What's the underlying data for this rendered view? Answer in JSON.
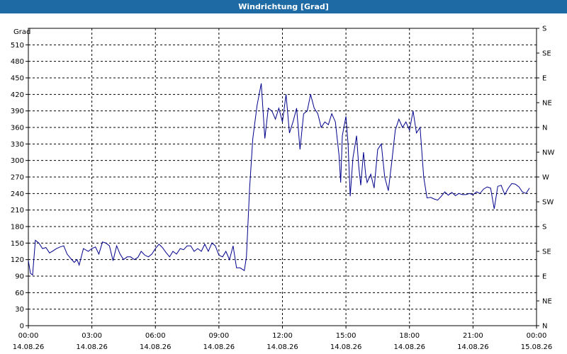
{
  "window": {
    "title": "Windrichtung [Grad]"
  },
  "chart_data": {
    "type": "line",
    "title": "Windrichtung [Grad]",
    "ylabel": "Grad",
    "ylim": [
      0,
      540
    ],
    "xlim": [
      0,
      24
    ],
    "grid": true,
    "line_color": "#00008b",
    "y_ticks": [
      0,
      30,
      60,
      90,
      120,
      150,
      180,
      210,
      240,
      270,
      300,
      330,
      360,
      390,
      420,
      450,
      480,
      510
    ],
    "y2_ticks": [
      {
        "value": 0,
        "label": "N"
      },
      {
        "value": 45,
        "label": "NE"
      },
      {
        "value": 90,
        "label": "E"
      },
      {
        "value": 135,
        "label": "SE"
      },
      {
        "value": 180,
        "label": "S"
      },
      {
        "value": 225,
        "label": "SW"
      },
      {
        "value": 270,
        "label": "W"
      },
      {
        "value": 315,
        "label": "NW"
      },
      {
        "value": 360,
        "label": "N"
      },
      {
        "value": 405,
        "label": "NE"
      },
      {
        "value": 450,
        "label": "E"
      },
      {
        "value": 495,
        "label": "SE"
      },
      {
        "value": 540,
        "label": "S"
      }
    ],
    "x_ticks": [
      {
        "hour": 0,
        "time": "00:00",
        "date": "14.08.26"
      },
      {
        "hour": 3,
        "time": "03:00",
        "date": "14.08.26"
      },
      {
        "hour": 6,
        "time": "06:00",
        "date": "14.08.26"
      },
      {
        "hour": 9,
        "time": "09:00",
        "date": "14.08.26"
      },
      {
        "hour": 12,
        "time": "12:00",
        "date": "14.08.26"
      },
      {
        "hour": 15,
        "time": "15:00",
        "date": "14.08.26"
      },
      {
        "hour": 18,
        "time": "18:00",
        "date": "14.08.26"
      },
      {
        "hour": 21,
        "time": "21:00",
        "date": "14.08.26"
      },
      {
        "hour": 24,
        "time": "00:00",
        "date": "15.08.26"
      }
    ],
    "series": [
      {
        "points": [
          [
            0.0,
            118
          ],
          [
            0.1,
            95
          ],
          [
            0.2,
            92
          ],
          [
            0.33,
            155
          ],
          [
            0.5,
            150
          ],
          [
            0.67,
            140
          ],
          [
            0.83,
            142
          ],
          [
            1.0,
            132
          ],
          [
            1.17,
            136
          ],
          [
            1.33,
            140
          ],
          [
            1.5,
            143
          ],
          [
            1.67,
            145
          ],
          [
            1.83,
            130
          ],
          [
            2.0,
            122
          ],
          [
            2.17,
            115
          ],
          [
            2.3,
            120
          ],
          [
            2.4,
            110
          ],
          [
            2.5,
            125
          ],
          [
            2.6,
            140
          ],
          [
            2.83,
            135
          ],
          [
            3.0,
            140
          ],
          [
            3.17,
            143
          ],
          [
            3.33,
            130
          ],
          [
            3.5,
            152
          ],
          [
            3.67,
            150
          ],
          [
            3.83,
            145
          ],
          [
            4.0,
            118
          ],
          [
            4.17,
            145
          ],
          [
            4.33,
            130
          ],
          [
            4.5,
            120
          ],
          [
            4.67,
            125
          ],
          [
            4.83,
            125
          ],
          [
            5.0,
            120
          ],
          [
            5.17,
            124
          ],
          [
            5.33,
            135
          ],
          [
            5.5,
            128
          ],
          [
            5.67,
            125
          ],
          [
            5.83,
            130
          ],
          [
            6.0,
            140
          ],
          [
            6.17,
            148
          ],
          [
            6.33,
            142
          ],
          [
            6.5,
            133
          ],
          [
            6.67,
            125
          ],
          [
            6.83,
            135
          ],
          [
            7.0,
            130
          ],
          [
            7.17,
            140
          ],
          [
            7.33,
            138
          ],
          [
            7.5,
            145
          ],
          [
            7.67,
            145
          ],
          [
            7.83,
            135
          ],
          [
            8.0,
            140
          ],
          [
            8.17,
            135
          ],
          [
            8.33,
            148
          ],
          [
            8.5,
            135
          ],
          [
            8.67,
            150
          ],
          [
            8.83,
            145
          ],
          [
            9.0,
            128
          ],
          [
            9.17,
            125
          ],
          [
            9.33,
            135
          ],
          [
            9.5,
            120
          ],
          [
            9.67,
            145
          ],
          [
            9.83,
            105
          ],
          [
            10.0,
            105
          ],
          [
            10.2,
            100
          ],
          [
            10.3,
            125
          ],
          [
            10.45,
            250
          ],
          [
            10.6,
            340
          ],
          [
            10.8,
            400
          ],
          [
            11.0,
            440
          ],
          [
            11.17,
            340
          ],
          [
            11.33,
            395
          ],
          [
            11.5,
            390
          ],
          [
            11.67,
            375
          ],
          [
            11.83,
            395
          ],
          [
            12.0,
            370
          ],
          [
            12.17,
            420
          ],
          [
            12.33,
            350
          ],
          [
            12.5,
            370
          ],
          [
            12.67,
            395
          ],
          [
            12.83,
            320
          ],
          [
            13.0,
            385
          ],
          [
            13.17,
            390
          ],
          [
            13.33,
            420
          ],
          [
            13.5,
            395
          ],
          [
            13.67,
            385
          ],
          [
            13.83,
            360
          ],
          [
            14.0,
            370
          ],
          [
            14.17,
            365
          ],
          [
            14.33,
            385
          ],
          [
            14.5,
            370
          ],
          [
            14.67,
            310
          ],
          [
            14.75,
            260
          ],
          [
            14.83,
            345
          ],
          [
            15.0,
            380
          ],
          [
            15.1,
            330
          ],
          [
            15.2,
            235
          ],
          [
            15.33,
            305
          ],
          [
            15.5,
            345
          ],
          [
            15.6,
            290
          ],
          [
            15.7,
            255
          ],
          [
            15.83,
            315
          ],
          [
            15.93,
            275
          ],
          [
            16.0,
            260
          ],
          [
            16.17,
            275
          ],
          [
            16.33,
            250
          ],
          [
            16.5,
            320
          ],
          [
            16.67,
            330
          ],
          [
            16.83,
            270
          ],
          [
            17.0,
            245
          ],
          [
            17.17,
            300
          ],
          [
            17.33,
            355
          ],
          [
            17.5,
            375
          ],
          [
            17.67,
            360
          ],
          [
            17.83,
            370
          ],
          [
            18.0,
            355
          ],
          [
            18.17,
            390
          ],
          [
            18.33,
            350
          ],
          [
            18.5,
            360
          ],
          [
            18.67,
            270
          ],
          [
            18.83,
            232
          ],
          [
            19.0,
            233
          ],
          [
            19.17,
            230
          ],
          [
            19.33,
            228
          ],
          [
            19.5,
            235
          ],
          [
            19.67,
            243
          ],
          [
            19.83,
            237
          ],
          [
            20.0,
            242
          ],
          [
            20.17,
            236
          ],
          [
            20.33,
            240
          ],
          [
            20.5,
            238
          ],
          [
            20.67,
            238
          ],
          [
            20.83,
            240
          ],
          [
            21.0,
            238
          ],
          [
            21.17,
            243
          ],
          [
            21.33,
            240
          ],
          [
            21.5,
            248
          ],
          [
            21.67,
            252
          ],
          [
            21.83,
            250
          ],
          [
            22.0,
            212
          ],
          [
            22.17,
            253
          ],
          [
            22.33,
            255
          ],
          [
            22.5,
            238
          ],
          [
            22.67,
            250
          ],
          [
            22.83,
            258
          ],
          [
            23.0,
            257
          ],
          [
            23.17,
            252
          ],
          [
            23.33,
            243
          ],
          [
            23.5,
            240
          ],
          [
            23.67,
            250
          ]
        ]
      }
    ]
  }
}
